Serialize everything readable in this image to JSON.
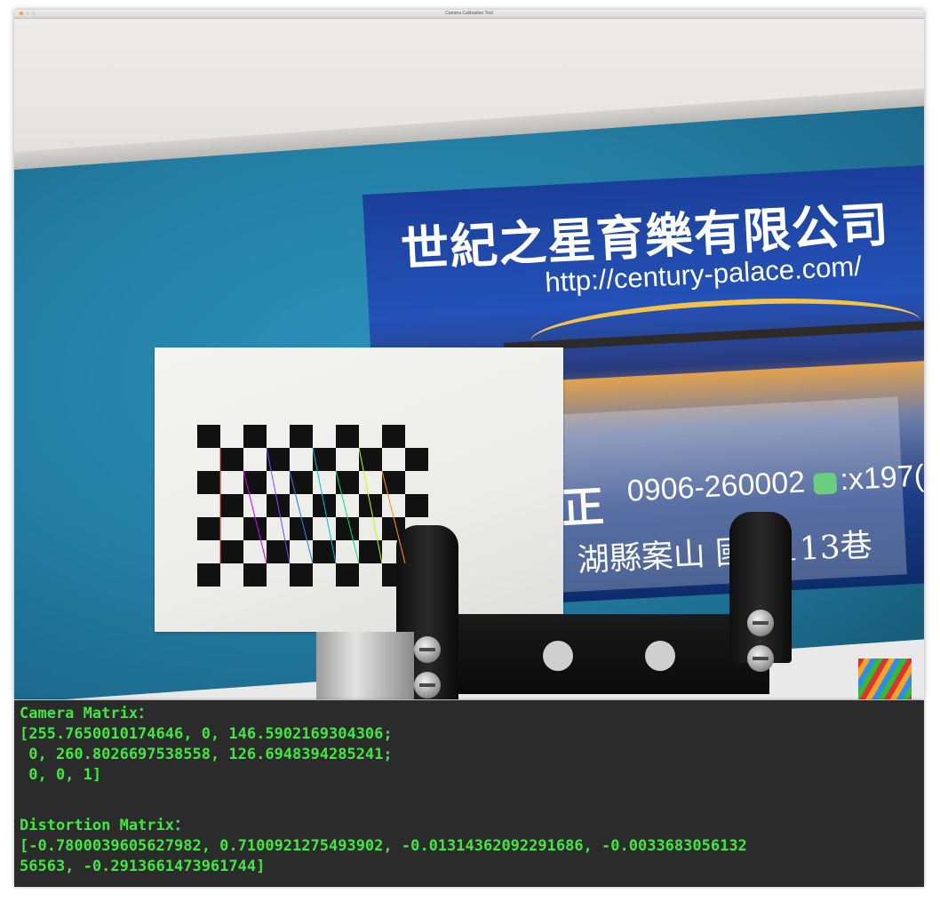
{
  "window": {
    "title": "Camera Calibration Tool",
    "traffic_lights": [
      "close",
      "minimize",
      "maximize"
    ]
  },
  "photo": {
    "card_title": "世紀之星育樂有限公司",
    "card_url": "http://century-palace.com/",
    "card_char": "正",
    "card_phone": "0906-260002",
    "card_line_icon": "line-chat-icon",
    "card_line_id": ":x197(",
    "card_address": "湖縣案山 國路113巷"
  },
  "terminal": {
    "camera_label": "Camera Matrix：",
    "camera_row1": "[255.7650010174646, 0, 146.5902169304306;",
    "camera_row2": " 0, 260.8026697538558, 126.6948394285241;",
    "camera_row3": " 0, 0, 1]",
    "distortion_label": "Distortion Matrix：",
    "distortion_row1": "[-0.7800039605627982, 0.7100921275493902, -0.01314362092291686, -0.0033683056132",
    "distortion_row2": "56563, -0.2913661473961744]",
    "text_color": "#3ee83e",
    "background": "#2b2b2b"
  },
  "colors": {
    "accent_close": "#ee9f32",
    "board_blue": "#2580a6"
  }
}
